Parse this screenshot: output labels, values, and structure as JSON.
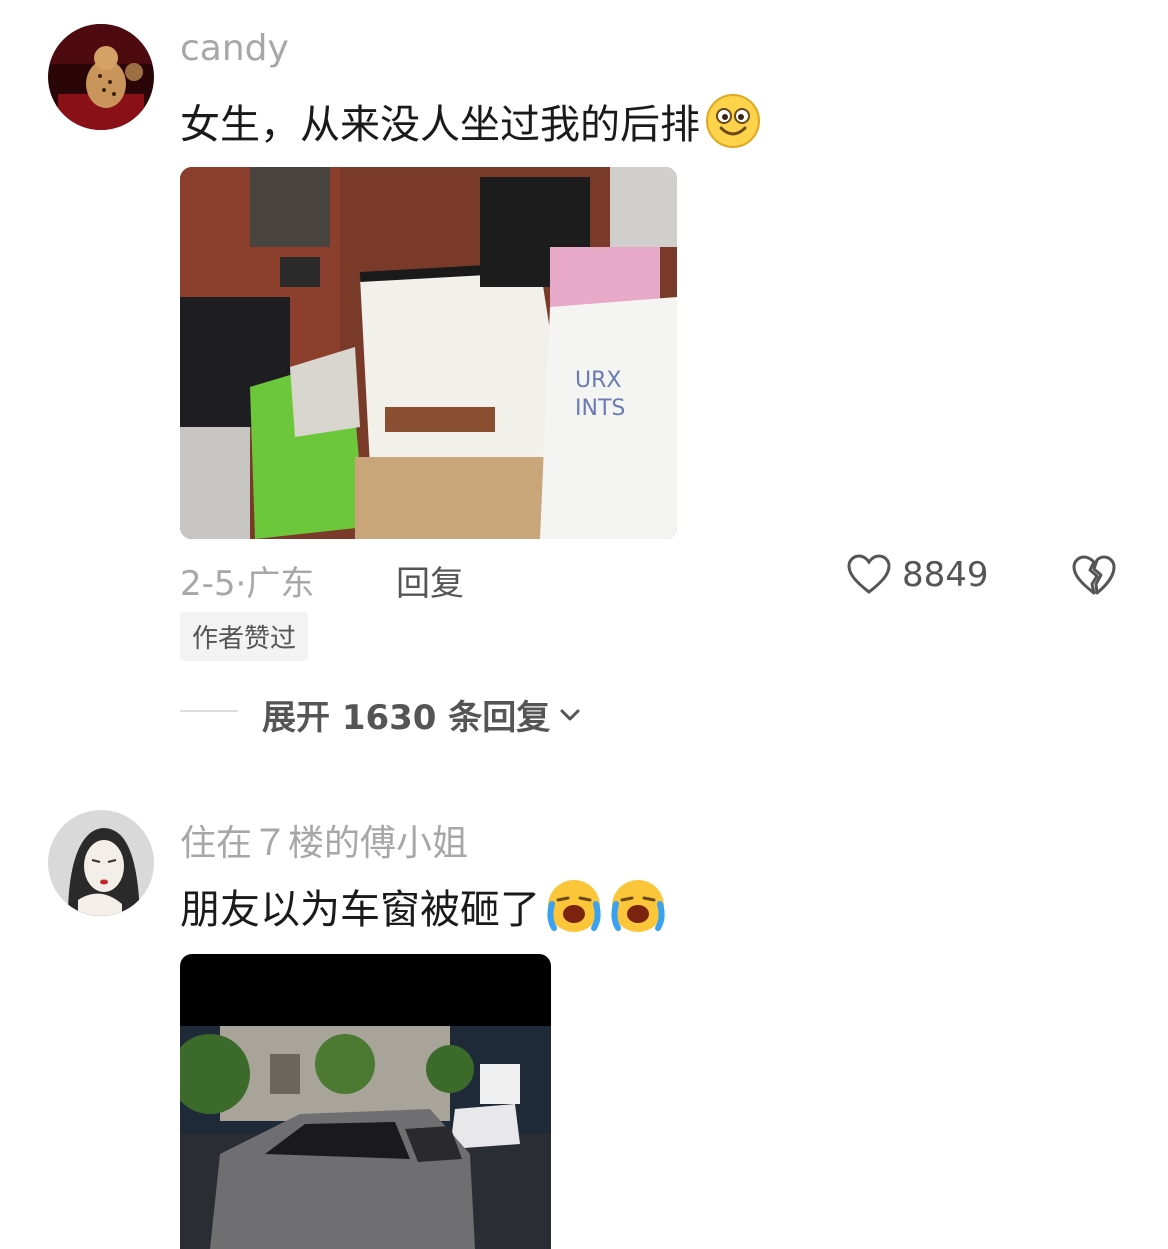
{
  "comments": [
    {
      "username": "candy",
      "text": "女生，从来没人坐过我的后排",
      "emojis": [
        "grinning-face"
      ],
      "date": "2-5",
      "location_sep": "·",
      "location": "广东",
      "reply_label": "回复",
      "like_count": "8849",
      "badge": "作者赞过",
      "expand_label": "展开 1630 条回复"
    },
    {
      "username": "住在７楼的傅小姐",
      "text": "朋友以为车窗被砸了",
      "emojis": [
        "loudly-crying-face",
        "loudly-crying-face"
      ]
    }
  ],
  "colors": {
    "meta_gray": "#a7a7a7",
    "text_dark": "#1a1a1a",
    "badge_bg": "#f3f3f3"
  }
}
